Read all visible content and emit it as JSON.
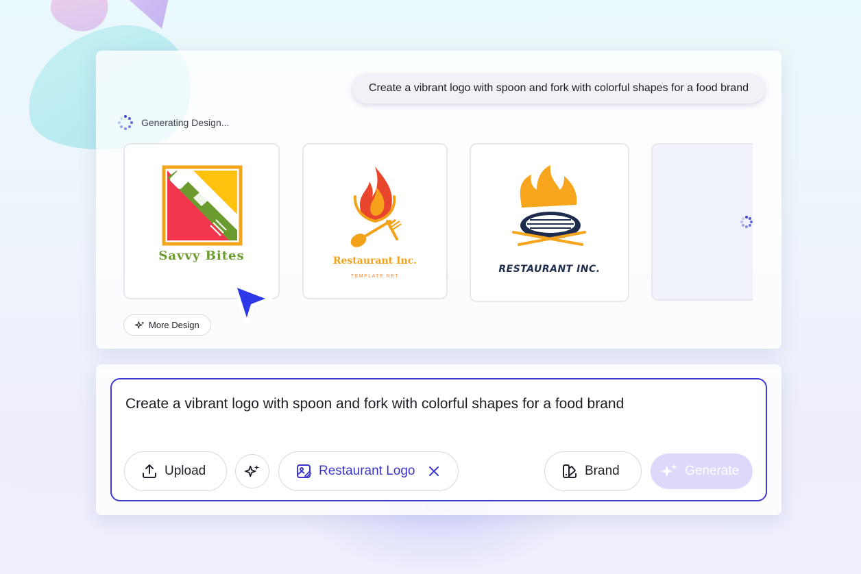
{
  "conversation": {
    "prompt_bubble": "Create a vibrant logo with spoon and fork with colorful shapes for a food brand",
    "status_text": "Generating Design..."
  },
  "results": {
    "designs": [
      {
        "logo_text": "Savvy Bites",
        "colors": [
          "#f2a51b",
          "#6b9a2e",
          "#f2364e",
          "#ffc20e"
        ]
      },
      {
        "logo_text": "Restaurant Inc.",
        "subtitle": "TEMPLATE.NET",
        "colors": [
          "#f1a21a",
          "#e8452c"
        ]
      },
      {
        "logo_text": "RESTAURANT INC.",
        "colors": [
          "#f6a51c",
          "#1e2c4e"
        ]
      },
      {
        "state": "loading"
      }
    ],
    "more_design_label": "More Design"
  },
  "composer": {
    "input_value": "Create a vibrant logo with spoon and fork with colorful shapes for a food brand",
    "upload_label": "Upload",
    "tag_label": "Restaurant Logo",
    "brand_label": "Brand",
    "generate_label": "Generate"
  },
  "icons": {
    "spinner": "spinner-icon",
    "sparkle": "sparkle-icon",
    "upload": "upload-icon",
    "image_edit": "image-edit-icon",
    "close": "close-icon",
    "brand": "brand-palette-icon",
    "cursor": "cursor-arrow-icon"
  },
  "theme": {
    "accent": "#3f3bd0",
    "generate_disabled_bg": "#dcd9fb",
    "spinner_color": "#3d43d8"
  }
}
